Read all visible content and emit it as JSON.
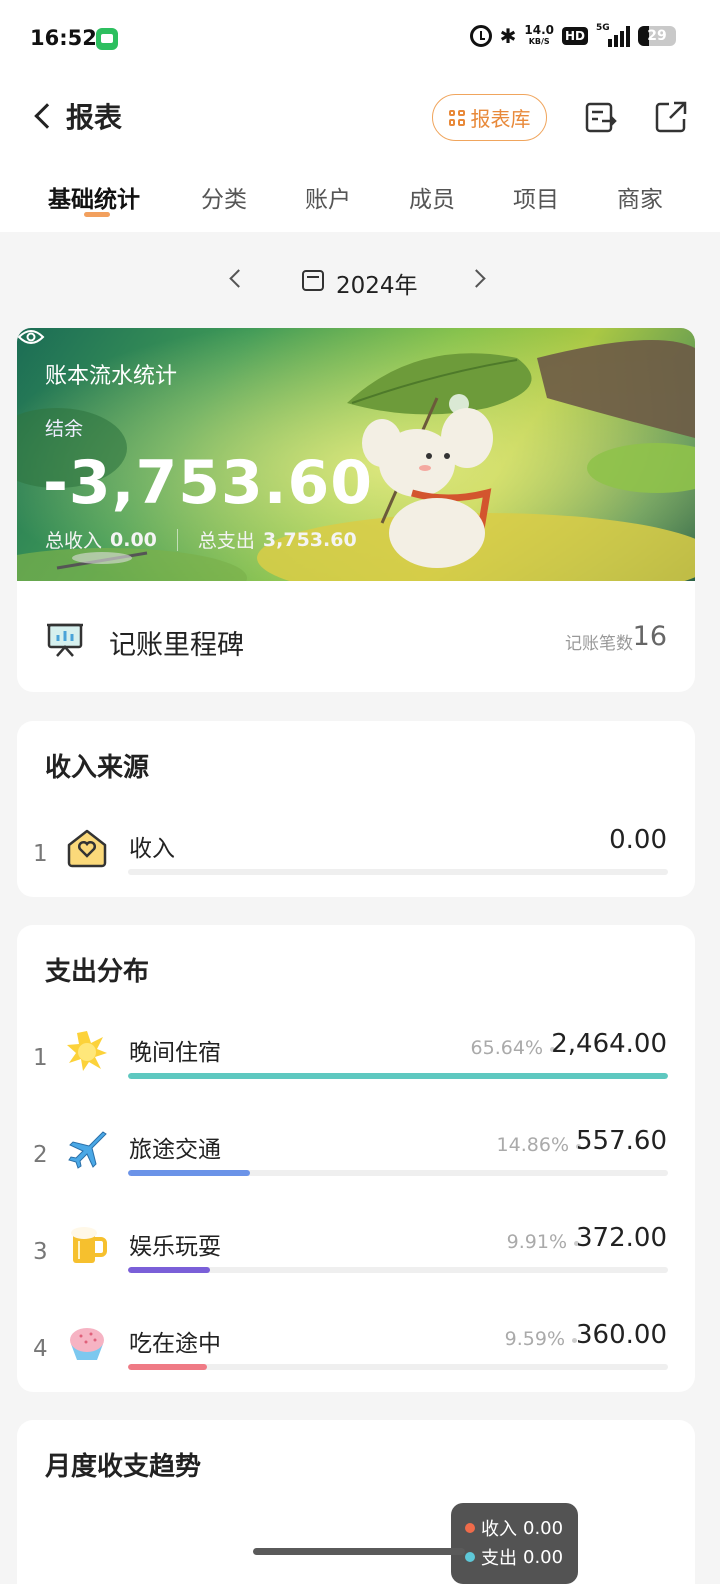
{
  "status_bar": {
    "time": "16:52",
    "network_speed": "14.0",
    "network_speed_unit": "KB/S",
    "hd": "HD",
    "network_type": "5G",
    "battery": "29"
  },
  "header": {
    "title": "报表",
    "report_library_label": "报表库"
  },
  "tabs": [
    {
      "label": "基础统计",
      "active": true
    },
    {
      "label": "分类"
    },
    {
      "label": "账户"
    },
    {
      "label": "成员"
    },
    {
      "label": "项目"
    },
    {
      "label": "商家"
    }
  ],
  "period": {
    "label": "2024年"
  },
  "banner": {
    "title": "账本流水统计",
    "balance_label": "结余",
    "balance": "-3,753.60",
    "income_label": "总收入",
    "income": "0.00",
    "expense_label": "总支出",
    "expense": "3,753.60"
  },
  "milestone": {
    "title": "记账里程碑",
    "count_label": "记账笔数",
    "count": "16"
  },
  "income_section": {
    "title": "收入来源",
    "items": [
      {
        "rank": "1",
        "label": "收入",
        "amount": "0.00",
        "icon": "house-heart-icon",
        "fraction": 0
      }
    ]
  },
  "expense_section": {
    "title": "支出分布",
    "items": [
      {
        "rank": "1",
        "label": "晚间住宿",
        "percent": "65.64%",
        "amount": "2,464.00",
        "icon": "sun-icon",
        "fraction": 1.0,
        "color": "#5ec8c0"
      },
      {
        "rank": "2",
        "label": "旅途交通",
        "percent": "14.86%",
        "amount": "557.60",
        "icon": "airplane-icon",
        "fraction": 0.2264,
        "color": "#6b93e8"
      },
      {
        "rank": "3",
        "label": "娱乐玩耍",
        "percent": "9.91%",
        "amount": "372.00",
        "icon": "beer-mug-icon",
        "fraction": 0.151,
        "color": "#7a5fd8"
      },
      {
        "rank": "4",
        "label": "吃在途中",
        "percent": "9.59%",
        "amount": "360.00",
        "icon": "shaved-ice-icon",
        "fraction": 0.1461,
        "color": "#ef7a85"
      }
    ]
  },
  "trend_section": {
    "title": "月度收支趋势",
    "tooltip": {
      "income_label": "收入",
      "income_value": "0.00",
      "income_color": "#ef6b4a",
      "expense_label": "支出",
      "expense_value": "0.00",
      "expense_color": "#5ec8d8"
    }
  }
}
